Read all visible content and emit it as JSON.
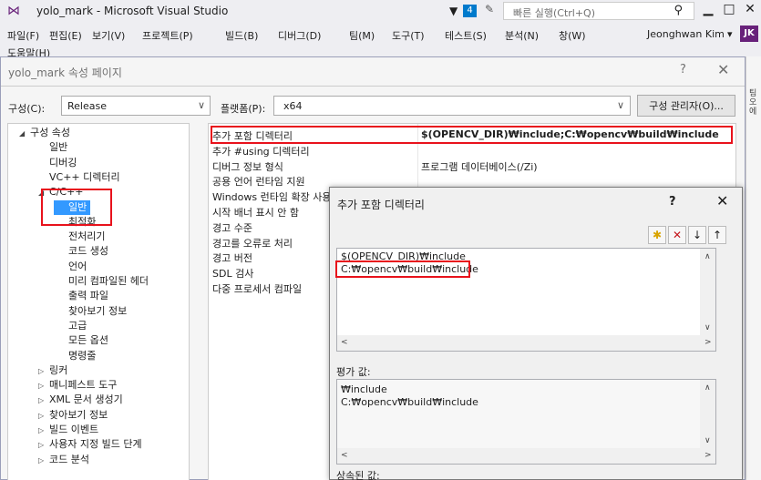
{
  "vs": {
    "title": "yolo_mark - Microsoft Visual Studio",
    "notification_count": "4",
    "quick_launch_placeholder": "빠른 실행(Ctrl+Q)",
    "user_name": "Jeonghwan Kim",
    "user_initials": "JK",
    "menu": [
      "파일(F)",
      "편집(E)",
      "보기(V)",
      "프로젝트(P)",
      "빌드(B)",
      "디버그(D)",
      "팀(M)",
      "도구(T)",
      "테스트(S)",
      "분석(N)",
      "창(W)"
    ],
    "menu_row2": "도움말(H)",
    "side_strip_text": "팀오에"
  },
  "property_page": {
    "title": "yolo_mark 속성 페이지",
    "help": "?",
    "close": "✕",
    "config_label": "구성(C):",
    "config_value": "Release",
    "platform_label": "플랫폼(P):",
    "platform_value": "x64",
    "config_manager_button": "구성 관리자(O)...",
    "tree": [
      {
        "label": "구성 속성",
        "arrow": "◢",
        "indent": 0
      },
      {
        "label": "일반",
        "arrow": "",
        "indent": 1
      },
      {
        "label": "디버깅",
        "arrow": "",
        "indent": 1
      },
      {
        "label": "VC++ 디렉터리",
        "arrow": "",
        "indent": 1
      },
      {
        "label": "C/C++",
        "arrow": "◢",
        "indent": 1
      },
      {
        "label": "일반",
        "arrow": "",
        "indent": 2,
        "selected": true
      },
      {
        "label": "최적화",
        "arrow": "",
        "indent": 2
      },
      {
        "label": "전처리기",
        "arrow": "",
        "indent": 2
      },
      {
        "label": "코드 생성",
        "arrow": "",
        "indent": 2
      },
      {
        "label": "언어",
        "arrow": "",
        "indent": 2
      },
      {
        "label": "미리 컴파일된 헤더",
        "arrow": "",
        "indent": 2
      },
      {
        "label": "출력 파일",
        "arrow": "",
        "indent": 2
      },
      {
        "label": "찾아보기 정보",
        "arrow": "",
        "indent": 2
      },
      {
        "label": "고급",
        "arrow": "",
        "indent": 2
      },
      {
        "label": "모든 옵션",
        "arrow": "",
        "indent": 2
      },
      {
        "label": "명령줄",
        "arrow": "",
        "indent": 2
      },
      {
        "label": "링커",
        "arrow": "▷",
        "indent": 1
      },
      {
        "label": "매니페스트 도구",
        "arrow": "▷",
        "indent": 1
      },
      {
        "label": "XML 문서 생성기",
        "arrow": "▷",
        "indent": 1
      },
      {
        "label": "찾아보기 정보",
        "arrow": "▷",
        "indent": 1
      },
      {
        "label": "빌드 이벤트",
        "arrow": "▷",
        "indent": 1
      },
      {
        "label": "사용자 지정 빌드 단계",
        "arrow": "▷",
        "indent": 1
      },
      {
        "label": "코드 분석",
        "arrow": "▷",
        "indent": 1
      }
    ],
    "grid": [
      {
        "name": "추가 포함 디렉터리",
        "value": "$(OPENCV_DIR)₩include;C:₩opencv₩build₩include",
        "selected": true
      },
      {
        "name": "추가 #using 디렉터리",
        "value": ""
      },
      {
        "name": "디버그 정보 형식",
        "value": "프로그램 데이터베이스(/Zi)"
      },
      {
        "name": "공용 언어 런타임 지원",
        "value": ""
      },
      {
        "name": "Windows 런타임 확장 사용",
        "value": ""
      },
      {
        "name": "시작 배너 표시 안 함",
        "value": ""
      },
      {
        "name": "경고 수준",
        "value": ""
      },
      {
        "name": "경고를 오류로 처리",
        "value": ""
      },
      {
        "name": "경고 버전",
        "value": ""
      },
      {
        "name": "SDL 검사",
        "value": ""
      },
      {
        "name": "다중 프로세서 컴파일",
        "value": ""
      }
    ]
  },
  "include_dialog": {
    "title": "추가 포함 디렉터리",
    "help": "?",
    "close": "✕",
    "entries": [
      "$(OPENCV_DIR)₩include",
      "C:₩opencv₩build₩include"
    ],
    "evaluated_label": "평가 값:",
    "evaluated_lines": [
      "₩include",
      "C:₩opencv₩build₩include"
    ],
    "inherited_label": "상속된 값:"
  }
}
